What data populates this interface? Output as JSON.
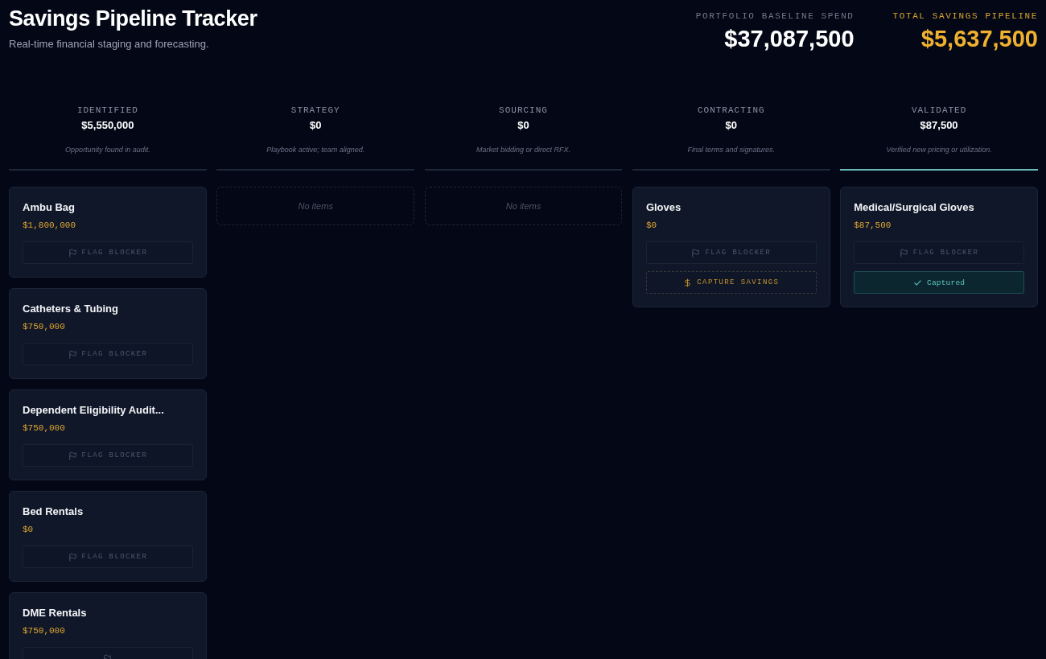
{
  "header": {
    "title": "Savings Pipeline Tracker",
    "subtitle": "Real-time financial staging and forecasting."
  },
  "summary": [
    {
      "kind": "baseline",
      "label": "PORTFOLIO BASELINE SPEND",
      "value": "$37,087,500"
    },
    {
      "kind": "pipeline",
      "label": "TOTAL SAVINGS PIPELINE",
      "value": "$5,637,500"
    }
  ],
  "stages": [
    {
      "name": "IDENTIFIED",
      "total": "$5,550,000",
      "description": "Opportunity found in audit.",
      "highlighted": false,
      "cards": [
        {
          "title": "Ambu Bag",
          "amount": "$1,800,000",
          "actions": [
            {
              "kind": "flag",
              "label": "FLAG BLOCKER"
            }
          ]
        },
        {
          "title": "Catheters & Tubing",
          "amount": "$750,000",
          "actions": [
            {
              "kind": "flag",
              "label": "FLAG BLOCKER"
            }
          ]
        },
        {
          "title": "Dependent Eligibility Audit...",
          "amount": "$750,000",
          "actions": [
            {
              "kind": "flag",
              "label": "FLAG BLOCKER"
            }
          ]
        },
        {
          "title": "Bed Rentals",
          "amount": "$0",
          "actions": [
            {
              "kind": "flag",
              "label": "FLAG BLOCKER"
            }
          ]
        },
        {
          "title": "DME Rentals",
          "amount": "$750,000",
          "actions": [
            {
              "kind": "flag"
            }
          ]
        }
      ]
    },
    {
      "name": "STRATEGY",
      "total": "$0",
      "description": "Playbook active; team aligned.",
      "highlighted": false,
      "empty_label": "No items"
    },
    {
      "name": "SOURCING",
      "total": "$0",
      "description": "Market bidding or direct RFX.",
      "highlighted": false,
      "empty_label": "No items"
    },
    {
      "name": "CONTRACTING",
      "total": "$0",
      "description": "Final terms and signatures.",
      "highlighted": false,
      "cards": [
        {
          "title": "Gloves",
          "amount": "$0",
          "actions": [
            {
              "kind": "flag",
              "label": "FLAG BLOCKER"
            },
            {
              "kind": "capture",
              "label": "CAPTURE SAVINGS"
            }
          ]
        }
      ]
    },
    {
      "name": "VALIDATED",
      "total": "$87,500",
      "description": "Verified new pricing or utilization.",
      "highlighted": true,
      "cards": [
        {
          "title": "Medical/Surgical Gloves",
          "amount": "$87,500",
          "actions": [
            {
              "kind": "flag",
              "label": "FLAG BLOCKER"
            },
            {
              "kind": "captured",
              "label": "Captured"
            }
          ]
        }
      ]
    }
  ]
}
